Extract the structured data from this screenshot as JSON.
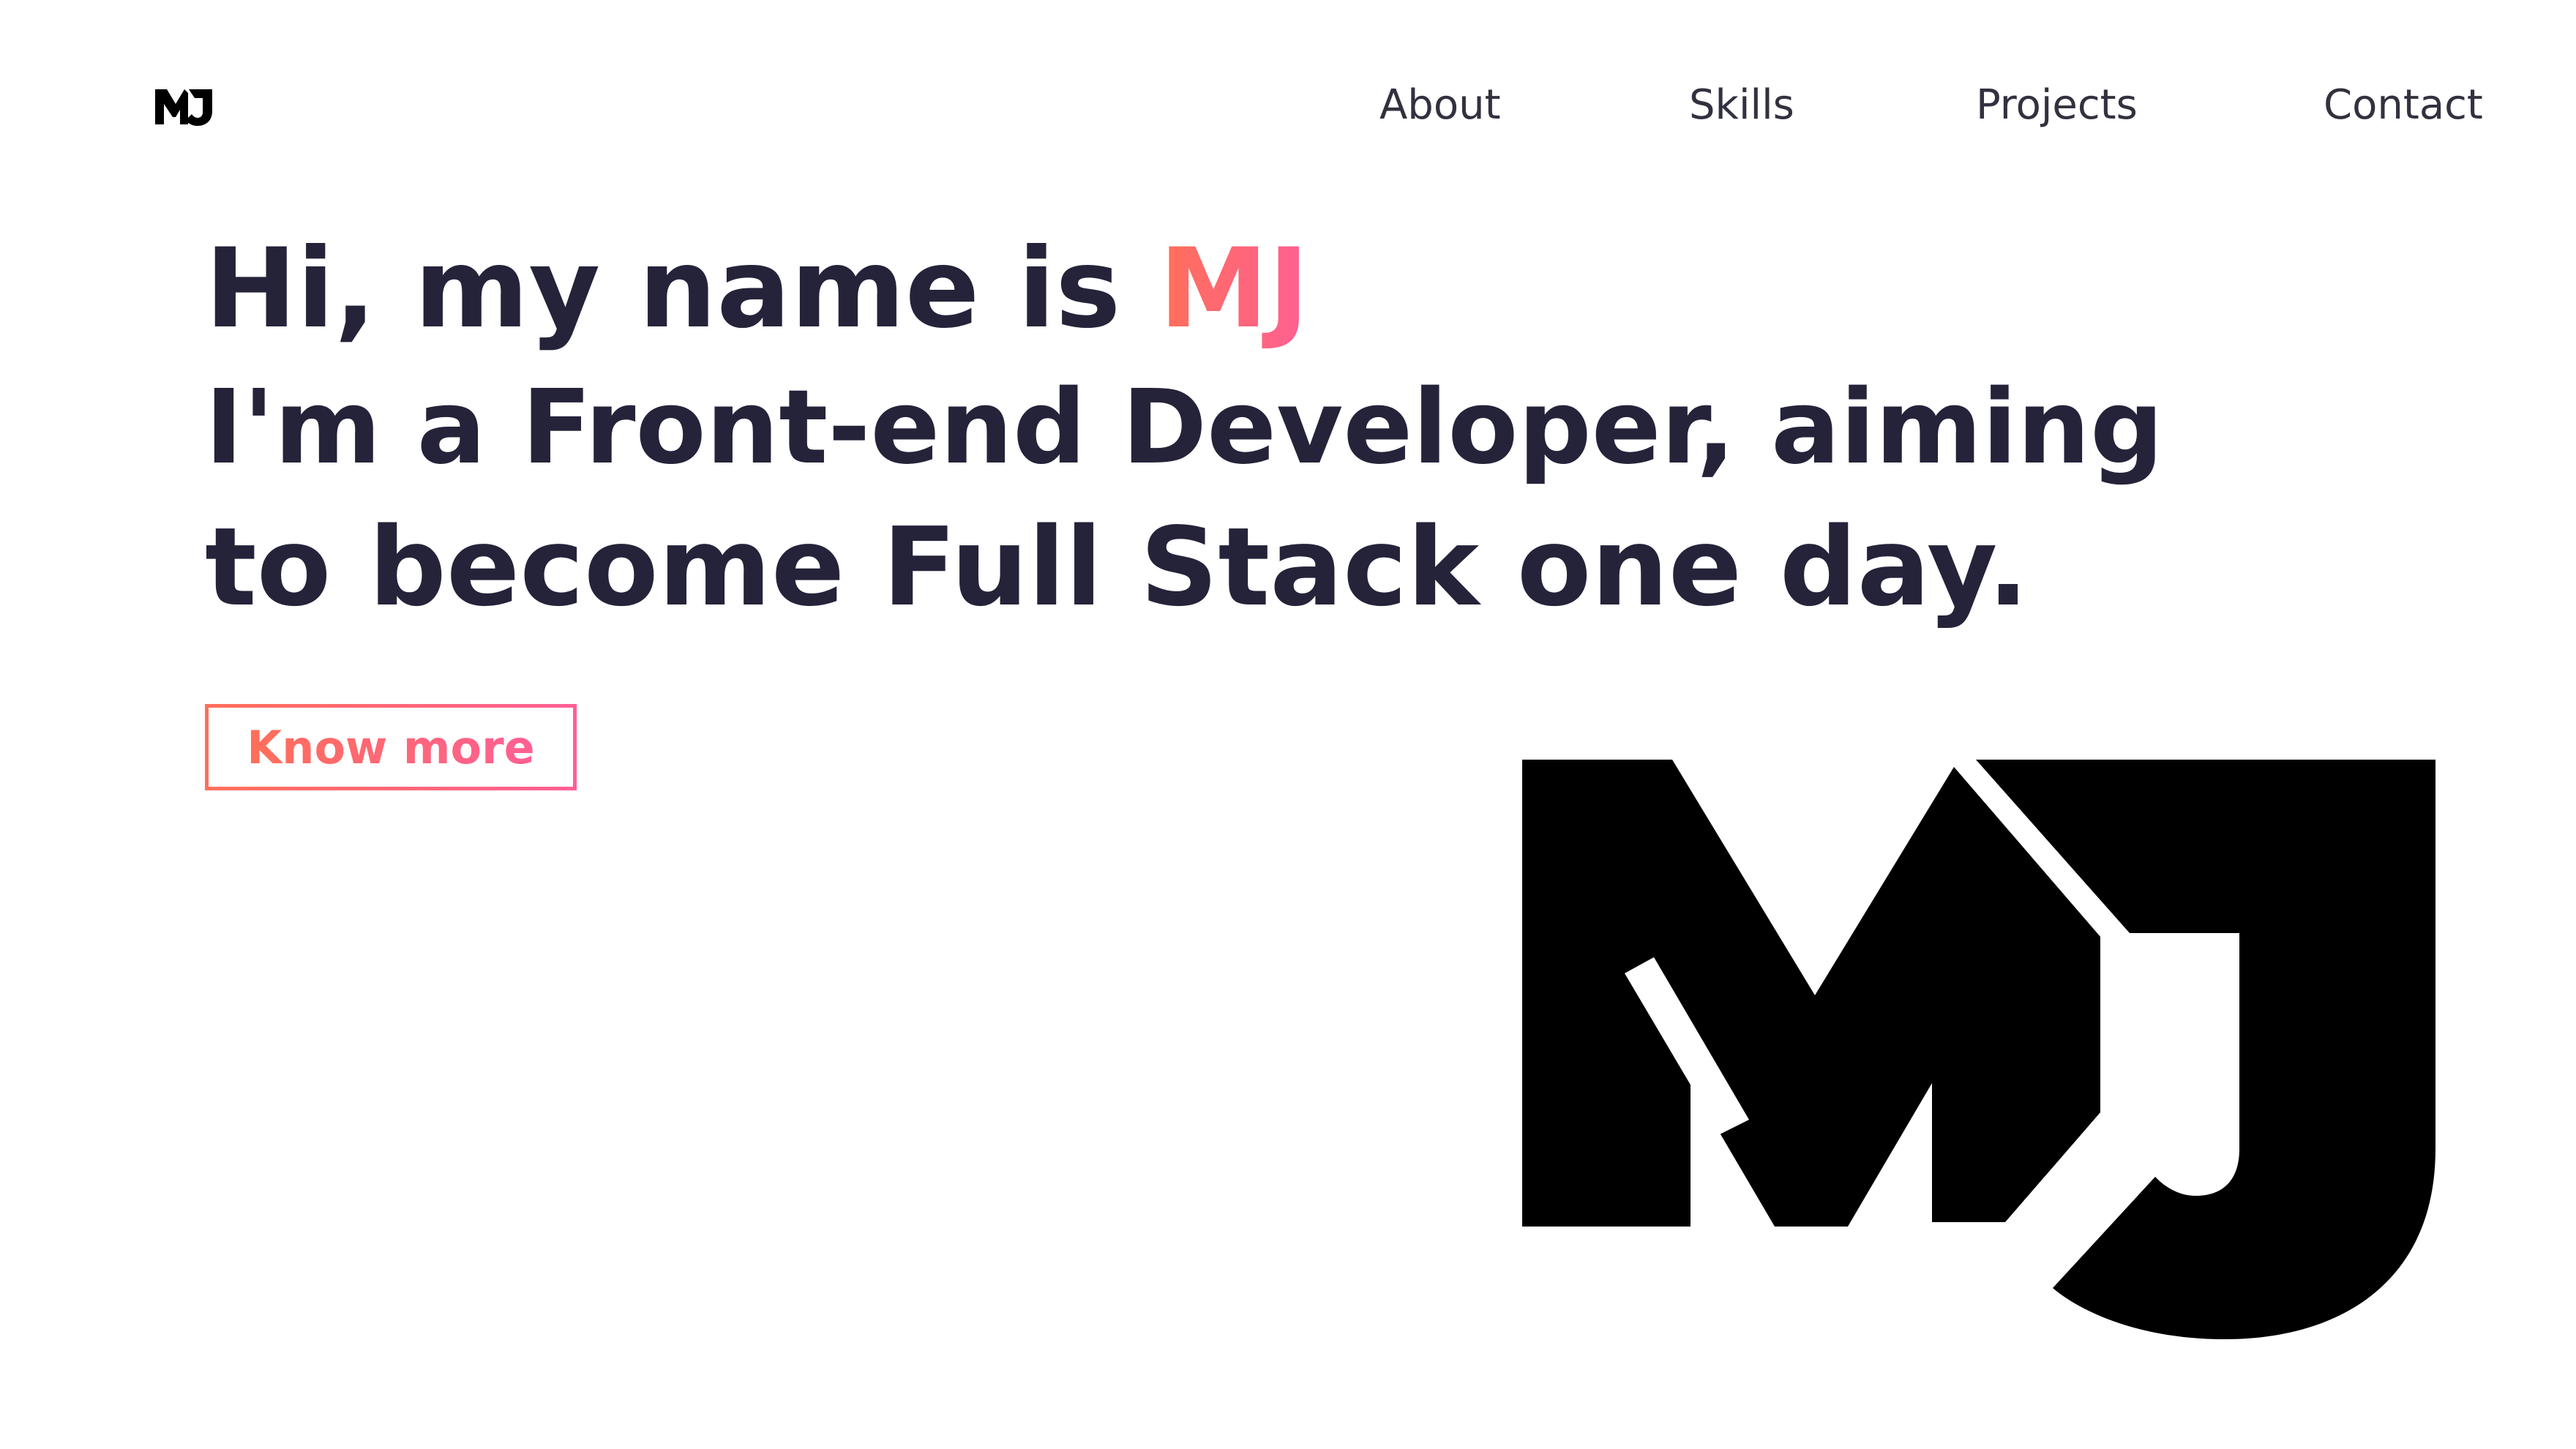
{
  "header": {
    "logo_text": "MJ",
    "nav": [
      "About",
      "Skills",
      "Projects",
      "Contact"
    ]
  },
  "hero": {
    "greeting_prefix": "Hi, my name is ",
    "name": "MJ",
    "line2": "I'm a Front-end Developer, aiming",
    "line3": "to become Full Stack one day.",
    "cta_label": "Know more"
  },
  "illustration": {
    "logo_text": "MJ"
  },
  "colors": {
    "text": "#25233a",
    "accent_start": "#ff6f59",
    "accent_end": "#ff5f94",
    "background": "#ffffff",
    "logo": "#000000"
  },
  "icons": {
    "header_logo": "mj-monogram-icon",
    "hero_logo": "mj-monogram-icon"
  }
}
